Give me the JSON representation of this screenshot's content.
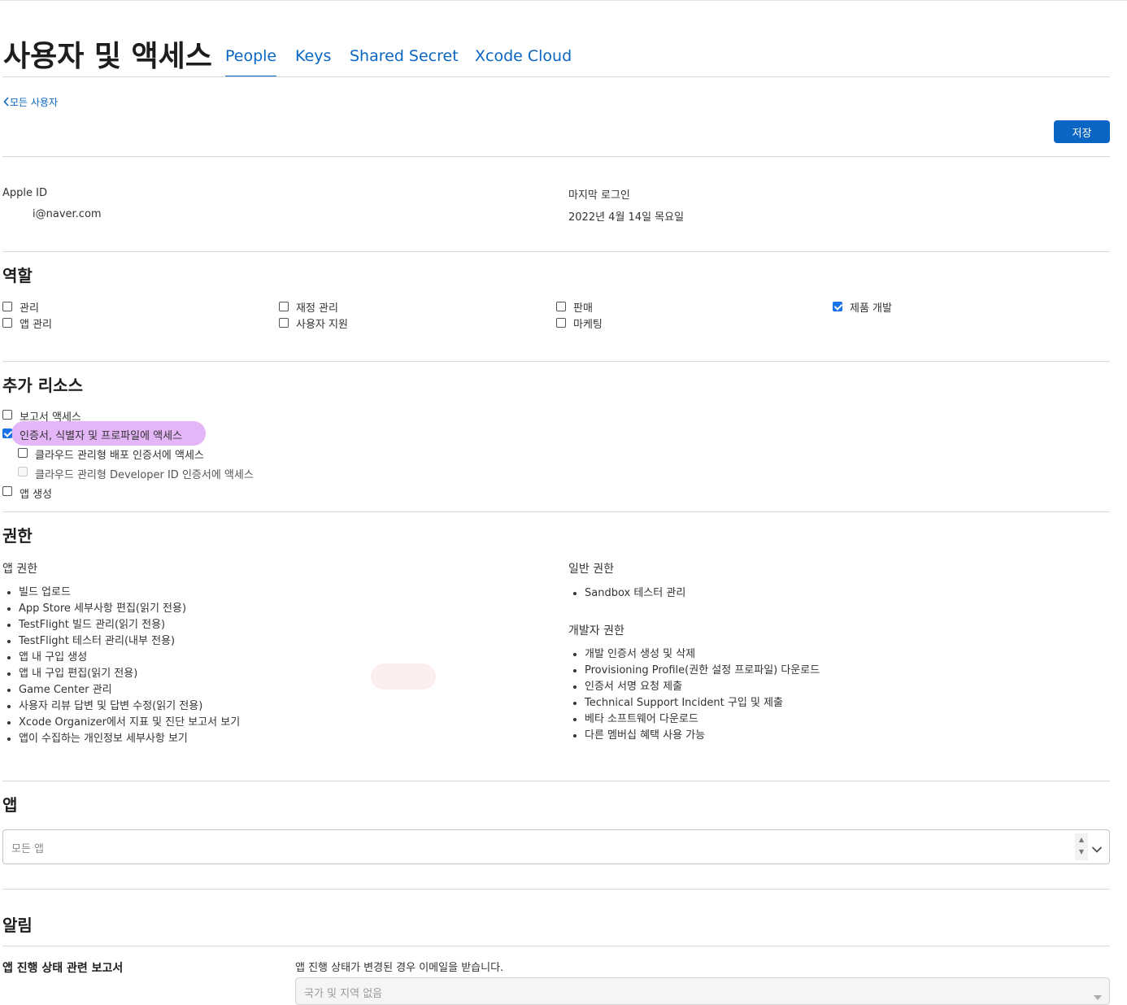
{
  "header": {
    "title": "사용자 및 액세스",
    "tabs": [
      {
        "label": "People",
        "active": true
      },
      {
        "label": "Keys",
        "active": false
      },
      {
        "label": "Shared Secret",
        "active": false
      },
      {
        "label": "Xcode Cloud",
        "active": false
      }
    ]
  },
  "toolbar": {
    "back_label": "모든 사용자",
    "save_label": "저장"
  },
  "account": {
    "apple_id_label": "Apple ID",
    "apple_id_value": "i@naver.com",
    "last_login_label": "마지막 로그인",
    "last_login_value": "2022년 4월 14일 목요일"
  },
  "roles": {
    "title": "역할",
    "items": [
      {
        "label": "관리",
        "checked": false
      },
      {
        "label": "재정 관리",
        "checked": false
      },
      {
        "label": "판매",
        "checked": false
      },
      {
        "label": "제품 개발",
        "checked": true
      },
      {
        "label": "앱 관리",
        "checked": false
      },
      {
        "label": "사용자 지원",
        "checked": false
      },
      {
        "label": "마케팅",
        "checked": false
      }
    ]
  },
  "resources": {
    "title": "추가 리소스",
    "items": [
      {
        "label": "보고서 액세스",
        "checked": false
      },
      {
        "label": "인증서, 식별자 및 프로파일에 액세스",
        "checked": true
      },
      {
        "label": "클라우드 관리형 배포 인증서에 액세스",
        "checked": false
      },
      {
        "label": "클라우드 관리형 Developer ID 인증서에 액세스",
        "checked": false,
        "disabled": true
      },
      {
        "label": "앱 생성",
        "checked": false
      }
    ]
  },
  "permissions": {
    "title": "권한",
    "app": {
      "title": "앱 권한",
      "items": [
        "빌드 업로드",
        "App Store 세부사항 편집(읽기 전용)",
        "TestFlight 빌드 관리(읽기 전용)",
        "TestFlight 테스터 관리(내부 전용)",
        "앱 내 구입 생성",
        "앱 내 구입 편집(읽기 전용)",
        "Game Center 관리",
        "사용자 리뷰 답변 및 답변 수정(읽기 전용)",
        "Xcode Organizer에서 지표 및 진단 보고서 보기",
        "앱이 수집하는 개인정보 세부사항 보기"
      ]
    },
    "general": {
      "title": "일반 권한",
      "items": [
        "Sandbox 테스터 관리"
      ]
    },
    "developer": {
      "title": "개발자 권한",
      "items": [
        "개발 인증서 생성 및 삭제",
        "Provisioning Profile(권한 설정 프로파일) 다운로드",
        "인증서 서명 요청 제출",
        "Technical Support Incident 구입 및 제출",
        "베타 소프트웨어 다운로드",
        "다른 멤버십 혜택 사용 가능"
      ]
    }
  },
  "apps": {
    "title": "앱",
    "placeholder": "모든 앱"
  },
  "notifications": {
    "title": "알림",
    "row_label": "앱 진행 상태 관련 보고서",
    "row_description": "앱 진행 상태가 변경된 경우 이메일을 받습니다.",
    "select_placeholder": "국가 및 지역 없음"
  },
  "colors": {
    "accent": "#0a66c2",
    "highlight": "#e4b5f7",
    "divider": "#d7d7d7"
  }
}
